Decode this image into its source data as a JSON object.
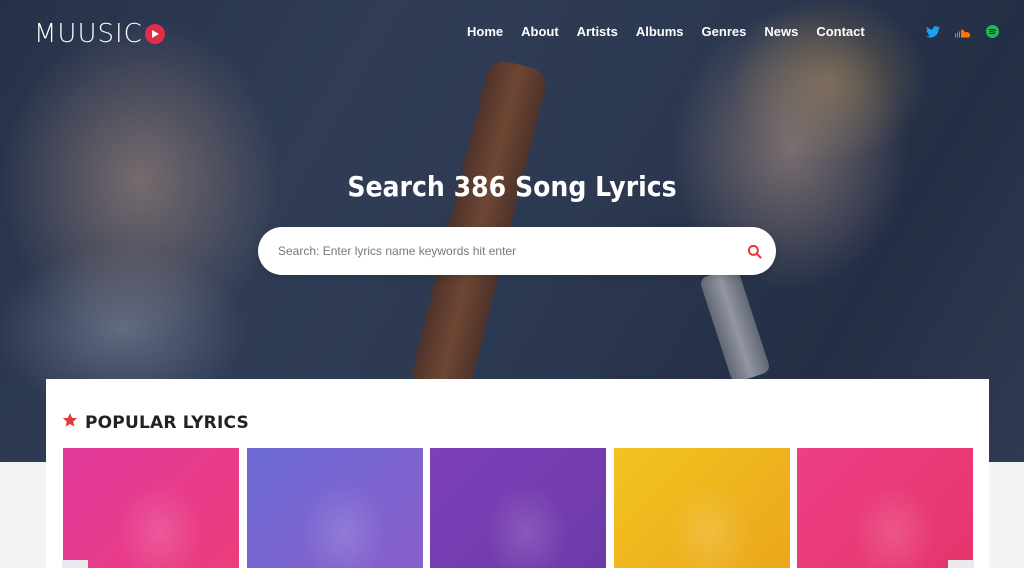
{
  "brand": {
    "logo_text": "MUUSIC"
  },
  "nav": {
    "items": [
      {
        "label": "Home"
      },
      {
        "label": "About"
      },
      {
        "label": "Artists"
      },
      {
        "label": "Albums"
      },
      {
        "label": "Genres"
      },
      {
        "label": "News"
      },
      {
        "label": "Contact"
      }
    ]
  },
  "social": {
    "icons": [
      "twitter-icon",
      "soundcloud-icon",
      "spotify-icon"
    ],
    "colors": {
      "twitter": "#1da1f2",
      "soundcloud": "#ff7700",
      "spotify": "#1db954"
    }
  },
  "hero": {
    "title": "Search 386 Song Lyrics",
    "search_placeholder": "Search: Enter lyrics name keywords hit enter"
  },
  "popular": {
    "heading": "POPULAR LYRICS",
    "cards": [
      {
        "color": "#e8398f"
      },
      {
        "color": "#7a66d2"
      },
      {
        "color": "#763db1"
      },
      {
        "color": "#f0b81e"
      },
      {
        "color": "#ea3a78"
      }
    ]
  },
  "colors": {
    "accent": "#e02d4a",
    "star": "#e03a3a"
  }
}
